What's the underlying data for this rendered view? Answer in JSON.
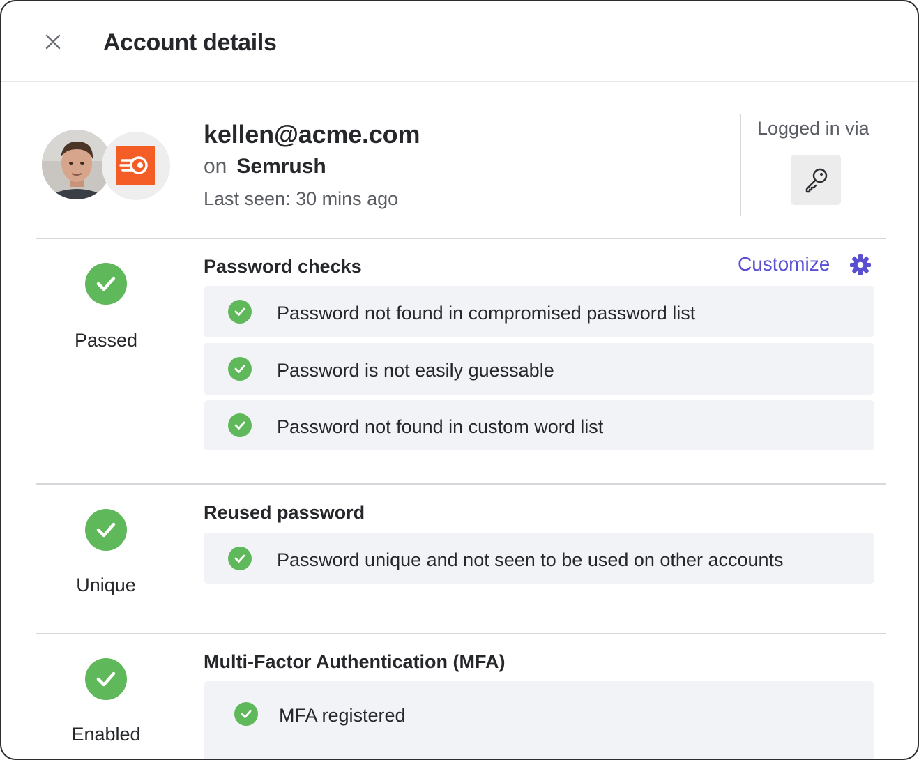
{
  "header": {
    "title": "Account details",
    "close_icon": "close-icon"
  },
  "account": {
    "email": "kellen@acme.com",
    "on_word": "on",
    "app_name": "Semrush",
    "last_seen": "Last seen: 30 mins ago",
    "logged_in_via_label": "Logged in via",
    "logged_in_via_icon": "key-icon",
    "app_brand_color": "#f45d26"
  },
  "sections": {
    "password_checks": {
      "status": "Passed",
      "title": "Password checks",
      "customize_label": "Customize",
      "items": [
        "Password not found in compromised password list",
        "Password is not easily guessable",
        "Password not found in custom word list"
      ]
    },
    "reused_password": {
      "status": "Unique",
      "title": "Reused password",
      "items": [
        "Password unique and not seen to be used on other accounts"
      ]
    },
    "mfa": {
      "status": "Enabled",
      "title": "Multi-Factor Authentication (MFA)",
      "items": [
        "MFA registered"
      ]
    }
  },
  "colors": {
    "success": "#5fb85a",
    "accent": "#5a4fd0",
    "row_background": "#f2f3f7"
  }
}
